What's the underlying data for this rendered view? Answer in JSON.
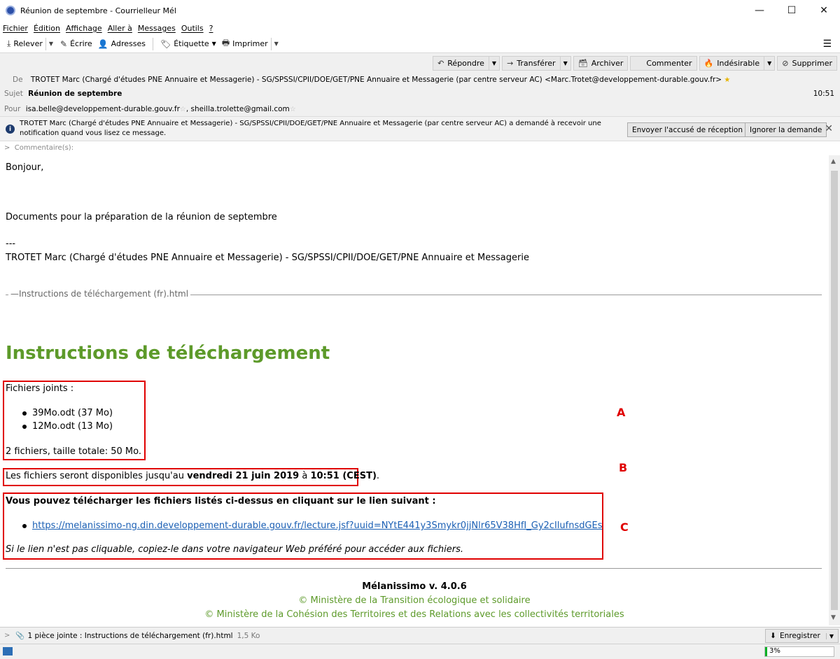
{
  "window": {
    "title": "Réunion de septembre - Courrielleur Mél",
    "controls": {
      "minimize": "—",
      "maximize": "☐",
      "close": "✕"
    }
  },
  "menu": [
    "Fichier",
    "Édition",
    "Affichage",
    "Aller à",
    "Messages",
    "Outils",
    "?"
  ],
  "toolbar": {
    "relever": "Relever",
    "ecrire": "Écrire",
    "adresses": "Adresses",
    "etiquette": "Étiquette",
    "imprimer": "Imprimer"
  },
  "actions": {
    "repondre": "Répondre",
    "transferer": "Transférer",
    "archiver": "Archiver",
    "commenter": "Commenter",
    "indesirable": "Indésirable",
    "supprimer": "Supprimer"
  },
  "header": {
    "from_key": "De",
    "from_value": "TROTET Marc (Chargé d'études PNE Annuaire et Messagerie) - SG/SPSSI/CPII/DOE/GET/PNE Annuaire et Messagerie (par centre serveur AC) <Marc.Trotet@developpement-durable.gouv.fr>",
    "subject_key": "Sujet",
    "subject_value": "Réunion de septembre",
    "to_key": "Pour",
    "to_value_1": "isa.belle@developpement-durable.gouv.fr",
    "to_value_2": ", sheilla.trolette@gmail.com",
    "time": "10:51"
  },
  "notification": {
    "text": "TROTET Marc (Chargé d'études PNE Annuaire et Messagerie) - SG/SPSSI/CPII/DOE/GET/PNE Annuaire et Messagerie (par centre serveur AC) a demandé à recevoir une notification quand vous lisez ce message.",
    "send_button": "Envoyer l'accusé de réception",
    "ignore_button": "Ignorer la demande"
  },
  "comment_label": "Commentaire(s):",
  "body": {
    "greeting": "Bonjour,",
    "line1": "Documents pour la préparation de la réunion de septembre",
    "sig_dash": "---",
    "signature": "TROTET Marc (Chargé d'études PNE Annuaire et Messagerie) - SG/SPSSI/CPII/DOE/GET/PNE Annuaire et Messagerie",
    "attachment_separator": "Instructions de téléchargement (fr).html",
    "title": "Instructions de téléchargement",
    "files_label": "Fichiers joints :",
    "files": [
      "39Mo.odt (37 Mo)",
      "12Mo.odt (13 Mo)"
    ],
    "files_total": "2 fichiers, taille totale: 50 Mo.",
    "availability_prefix": "Les fichiers seront disponibles jusqu'au ",
    "availability_date": "vendredi 21 juin 2019",
    "availability_mid": " à ",
    "availability_time": "10:51 (CEST)",
    "availability_suffix": ".",
    "download_intro": "Vous pouvez télécharger les fichiers listés ci-dessus en cliquant sur le lien suivant :",
    "download_link": "https://melanissimo-ng.din.developpement-durable.gouv.fr/lecture.jsf?uuid=NYtE441y3Smykr0jjNlr65V38HfI_Gy2cIlufnsdGEs",
    "download_note": "Si le lien n'est pas cliquable, copiez-le dans votre navigateur Web préféré pour accéder aux fichiers.",
    "markers": [
      "A",
      "B",
      "C"
    ],
    "footer_product": "Mélanissimo v. 4.0.6",
    "footer_copy1": "© Ministère de la Transition écologique et solidaire",
    "footer_copy2": "© Ministère de la Cohésion des Territoires et des Relations avec les collectivités territoriales"
  },
  "attachment_bar": {
    "label": "1 pièce jointe : Instructions de téléchargement (fr).html",
    "size": "1,5 Ko",
    "save": "Enregistrer"
  },
  "status": {
    "progress_text": "3%",
    "progress_fraction": 0.03
  },
  "colors": {
    "title_green": "#5d9a2a",
    "marker_red": "#e00000",
    "link_blue": "#1a5fb4"
  }
}
